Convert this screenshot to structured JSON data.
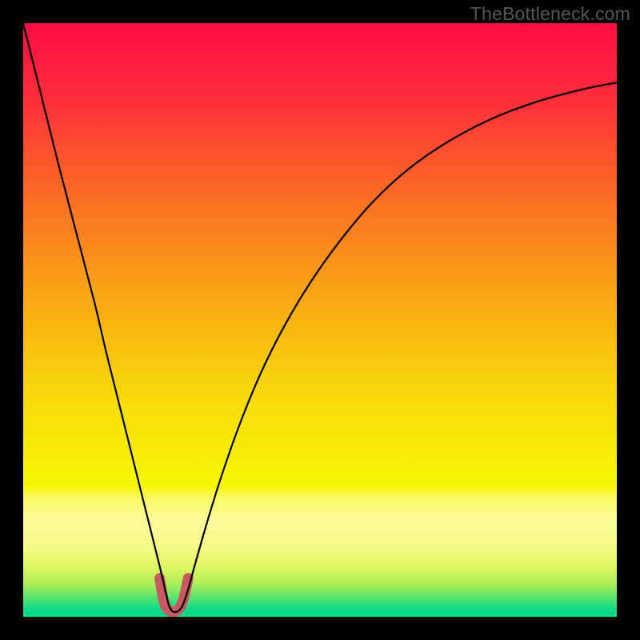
{
  "attribution": "TheBottleneck.com",
  "gradient": {
    "stops": [
      {
        "offset": 0.0,
        "color": "#fe0d45"
      },
      {
        "offset": 0.12,
        "color": "#fe2b3b"
      },
      {
        "offset": 0.28,
        "color": "#fb6825"
      },
      {
        "offset": 0.45,
        "color": "#f9a415"
      },
      {
        "offset": 0.62,
        "color": "#f8d80a"
      },
      {
        "offset": 0.78,
        "color": "#f7f705"
      },
      {
        "offset": 0.8,
        "color": "#faf965"
      },
      {
        "offset": 0.84,
        "color": "#fcfb9c"
      },
      {
        "offset": 0.88,
        "color": "#f7fa88"
      },
      {
        "offset": 0.915,
        "color": "#e2f764"
      },
      {
        "offset": 0.945,
        "color": "#aaee58"
      },
      {
        "offset": 0.965,
        "color": "#62e46c"
      },
      {
        "offset": 0.985,
        "color": "#14da85"
      },
      {
        "offset": 1.0,
        "color": "#07d88a"
      }
    ]
  },
  "chart_data": {
    "type": "line",
    "title": "",
    "xlabel": "",
    "ylabel": "",
    "xlim": [
      0,
      100
    ],
    "ylim": [
      0,
      100
    ],
    "series": [
      {
        "name": "bottleneck-curve",
        "x": [
          0,
          3,
          6,
          9,
          12,
          14,
          16,
          18,
          20,
          21.5,
          23,
          24,
          24.6,
          25.2,
          26,
          26.8,
          27.6,
          29,
          31,
          33.5,
          36.5,
          40,
          44,
          48.5,
          53.5,
          59,
          65,
          71.5,
          78.5,
          86,
          94,
          100
        ],
        "y": [
          100,
          88,
          76,
          64.5,
          53,
          44.5,
          36.5,
          28.5,
          20.5,
          14.5,
          8.5,
          4.2,
          1.8,
          0.9,
          0.9,
          1.8,
          4.0,
          9.0,
          16.0,
          24.0,
          32.5,
          41.0,
          49.0,
          56.5,
          63.5,
          70.0,
          75.5,
          80.0,
          83.7,
          86.6,
          88.8,
          90.0
        ]
      },
      {
        "name": "valley-marker",
        "x": [
          23.0,
          23.6,
          24.2,
          24.9,
          25.6,
          26.3,
          27.0,
          27.8
        ],
        "y": [
          6.5,
          3.0,
          1.4,
          0.9,
          0.9,
          1.4,
          3.0,
          6.5
        ]
      }
    ],
    "annotations": []
  },
  "styles": {
    "curve_stroke": "#000000",
    "curve_width": 2.2,
    "marker_stroke": "#c65a60",
    "marker_width": 13
  }
}
